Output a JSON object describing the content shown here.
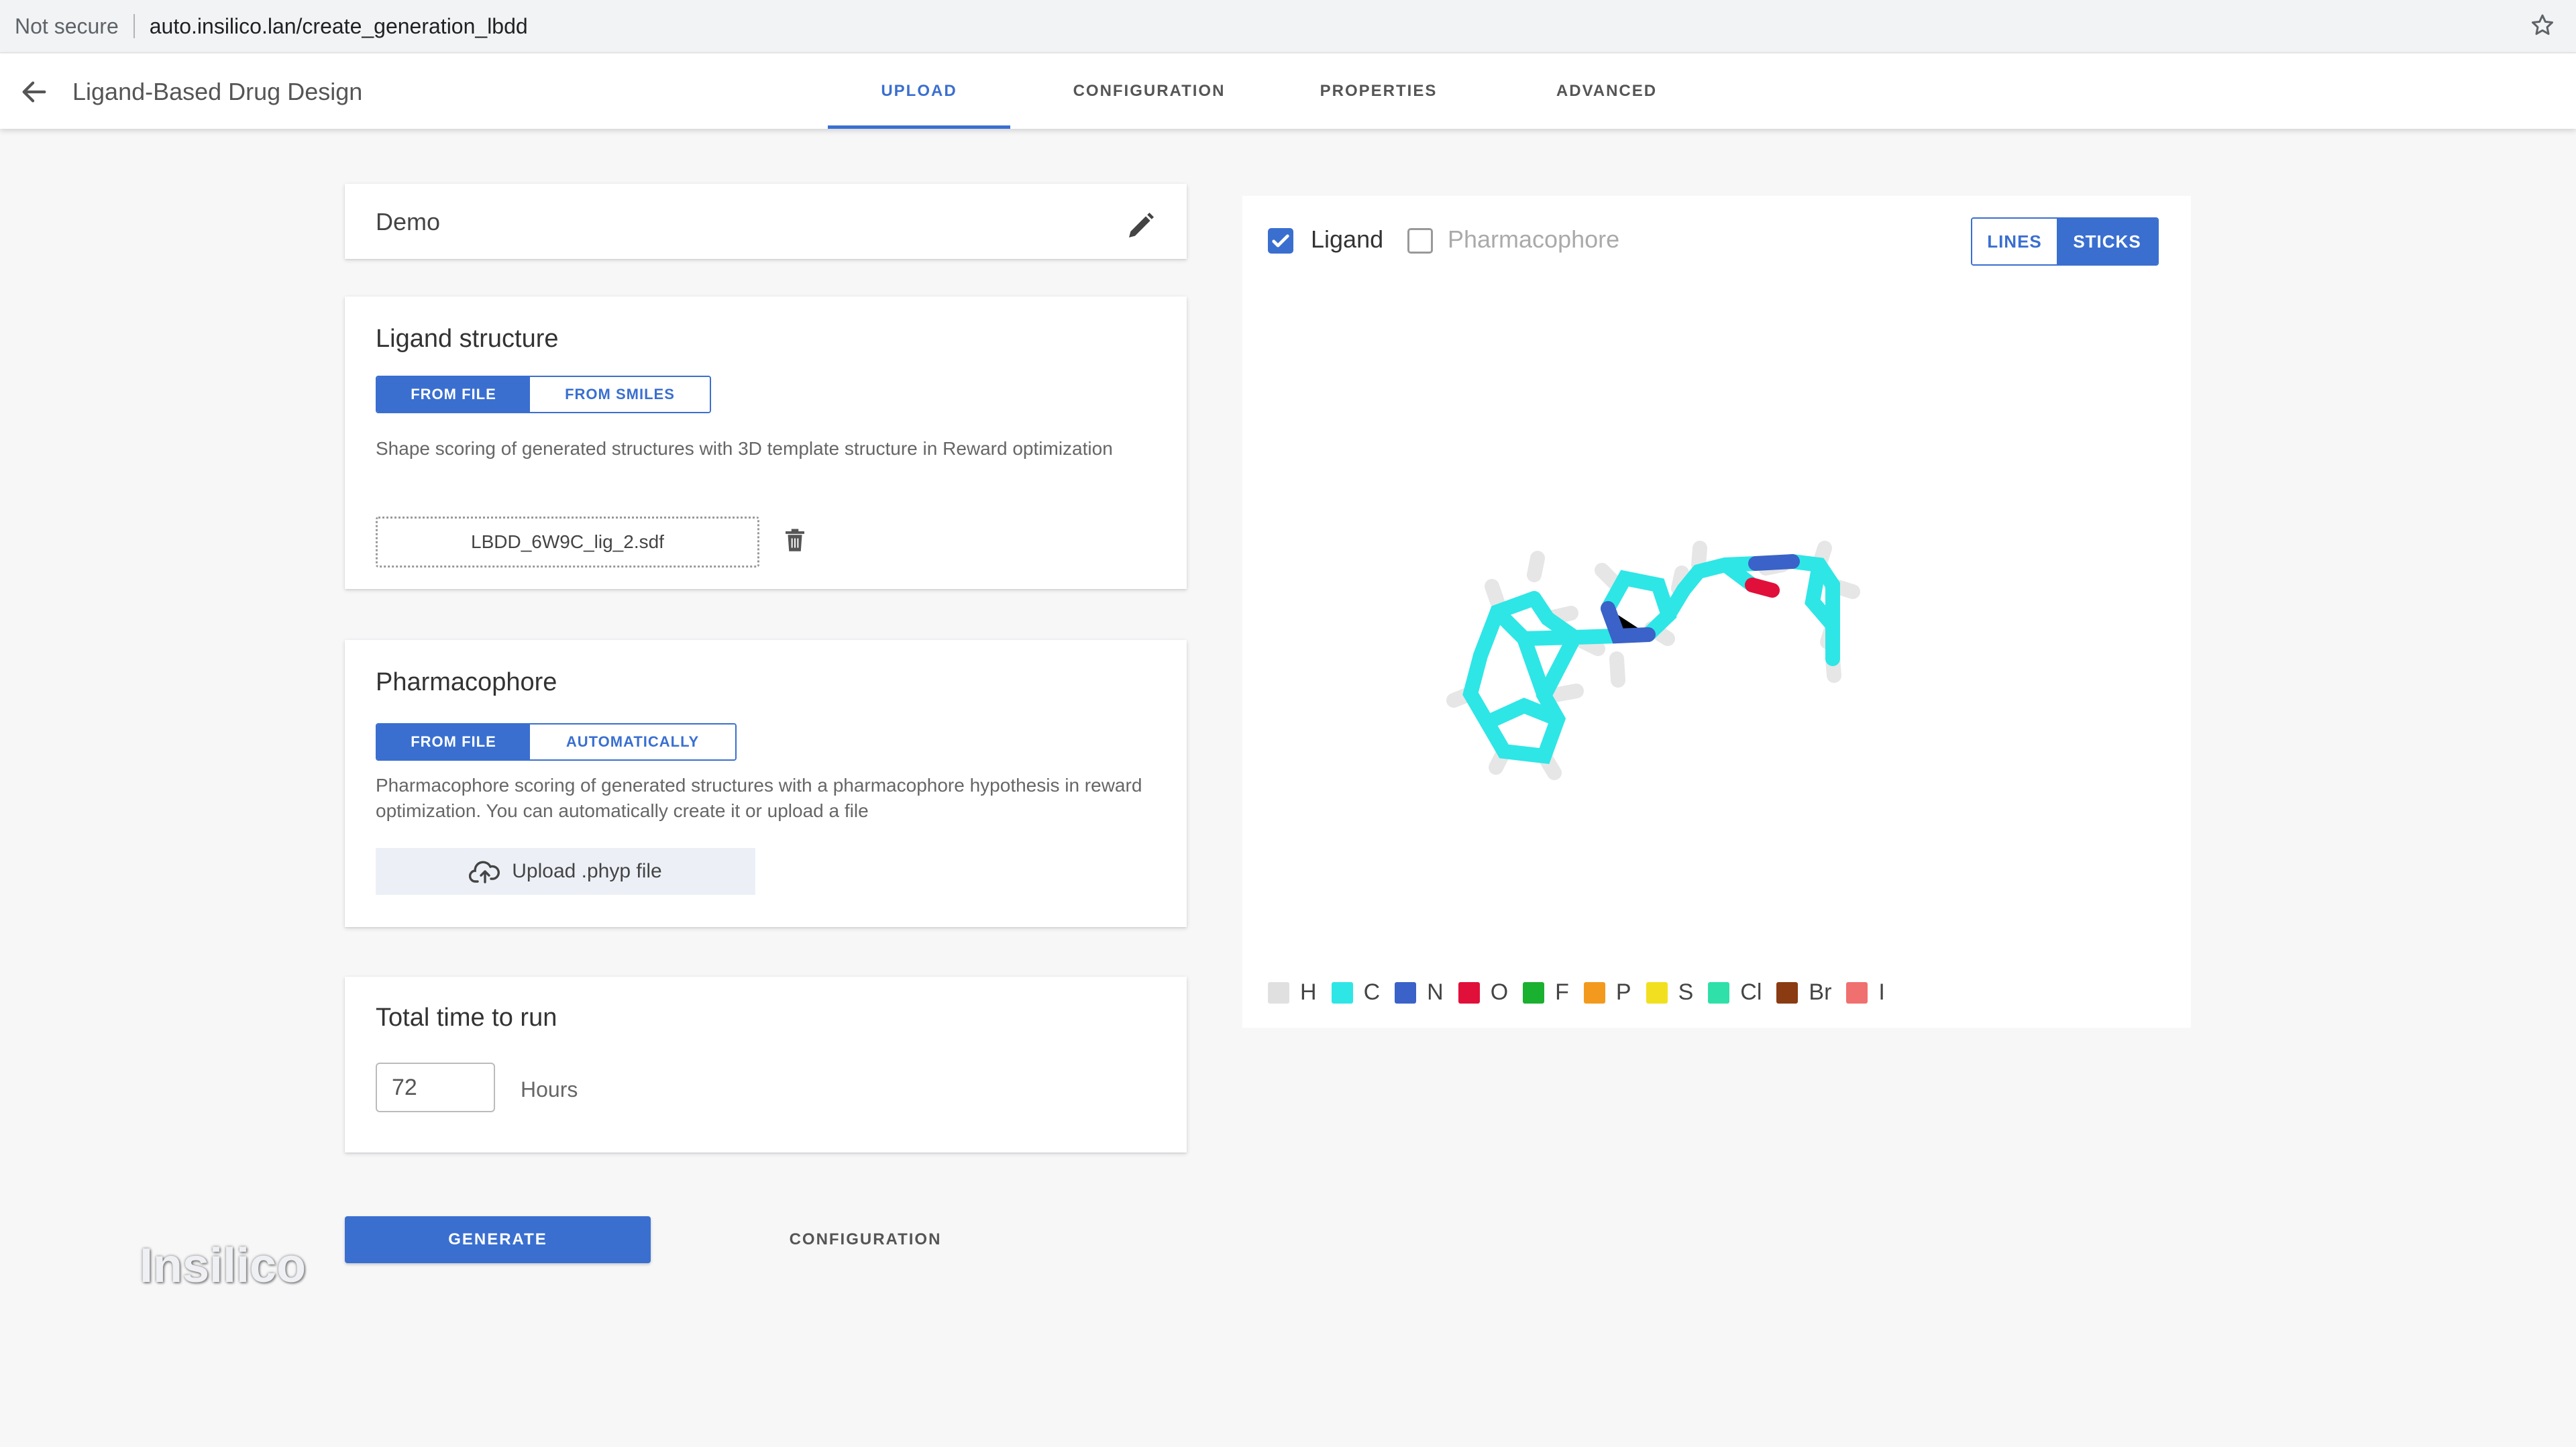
{
  "browser": {
    "security_label": "Not secure",
    "url": "auto.insilico.lan/create_generation_lbdd"
  },
  "header": {
    "title": "Ligand-Based Drug Design",
    "tabs": [
      {
        "label": "UPLOAD",
        "active": true
      },
      {
        "label": "CONFIGURATION",
        "active": false
      },
      {
        "label": "PROPERTIES",
        "active": false
      },
      {
        "label": "ADVANCED",
        "active": false
      }
    ]
  },
  "project": {
    "name": "Demo"
  },
  "ligand": {
    "title": "Ligand structure",
    "options": [
      "FROM FILE",
      "FROM SMILES"
    ],
    "selected": "FROM FILE",
    "description": "Shape scoring of generated structures with 3D template structure in Reward optimization",
    "file_name": "LBDD_6W9C_lig_2.sdf"
  },
  "pharmacophore": {
    "title": "Pharmacophore",
    "options": [
      "FROM FILE",
      "AUTOMATICALLY"
    ],
    "selected": "FROM FILE",
    "description": "Pharmacophore scoring of generated structures with a pharmacophore hypothesis in reward optimization. You can automatically create it or upload a file",
    "upload_label": "Upload .phyp file"
  },
  "runtime": {
    "title": "Total time to run",
    "value": "72",
    "unit": "Hours"
  },
  "actions": {
    "generate": "GENERATE",
    "configuration": "CONFIGURATION"
  },
  "watermark": "Insilico",
  "viewer": {
    "ligand_label": "Ligand",
    "ligand_checked": true,
    "pharmacophore_label": "Pharmacophore",
    "pharmacophore_checked": false,
    "modes": [
      "LINES",
      "STICKS"
    ],
    "selected_mode": "STICKS",
    "legend": [
      {
        "label": "H",
        "color": "#e0e0e0"
      },
      {
        "label": "C",
        "color": "#2ee6e6"
      },
      {
        "label": "N",
        "color": "#3a62c8"
      },
      {
        "label": "O",
        "color": "#e0103a"
      },
      {
        "label": "F",
        "color": "#1ab030"
      },
      {
        "label": "P",
        "color": "#f39a1e"
      },
      {
        "label": "S",
        "color": "#f2e020"
      },
      {
        "label": "Cl",
        "color": "#2fe0a8"
      },
      {
        "label": "Br",
        "color": "#8a3b12"
      },
      {
        "label": "I",
        "color": "#f07070"
      }
    ]
  }
}
